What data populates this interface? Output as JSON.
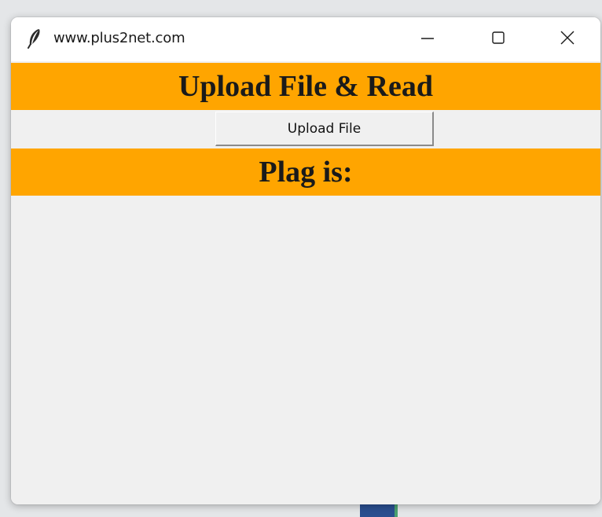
{
  "window": {
    "title": "www.plus2net.com",
    "icon": "feather-icon",
    "controls": [
      "minimize-icon",
      "maximize-icon",
      "close-icon"
    ]
  },
  "header": {
    "title": "Upload File & Read"
  },
  "upload": {
    "button_label": "Upload File"
  },
  "result": {
    "label": "Plag is:"
  },
  "colors": {
    "banner": "#ffa500",
    "window_bg": "#f0f0f0",
    "titlebar_bg": "#ffffff"
  }
}
